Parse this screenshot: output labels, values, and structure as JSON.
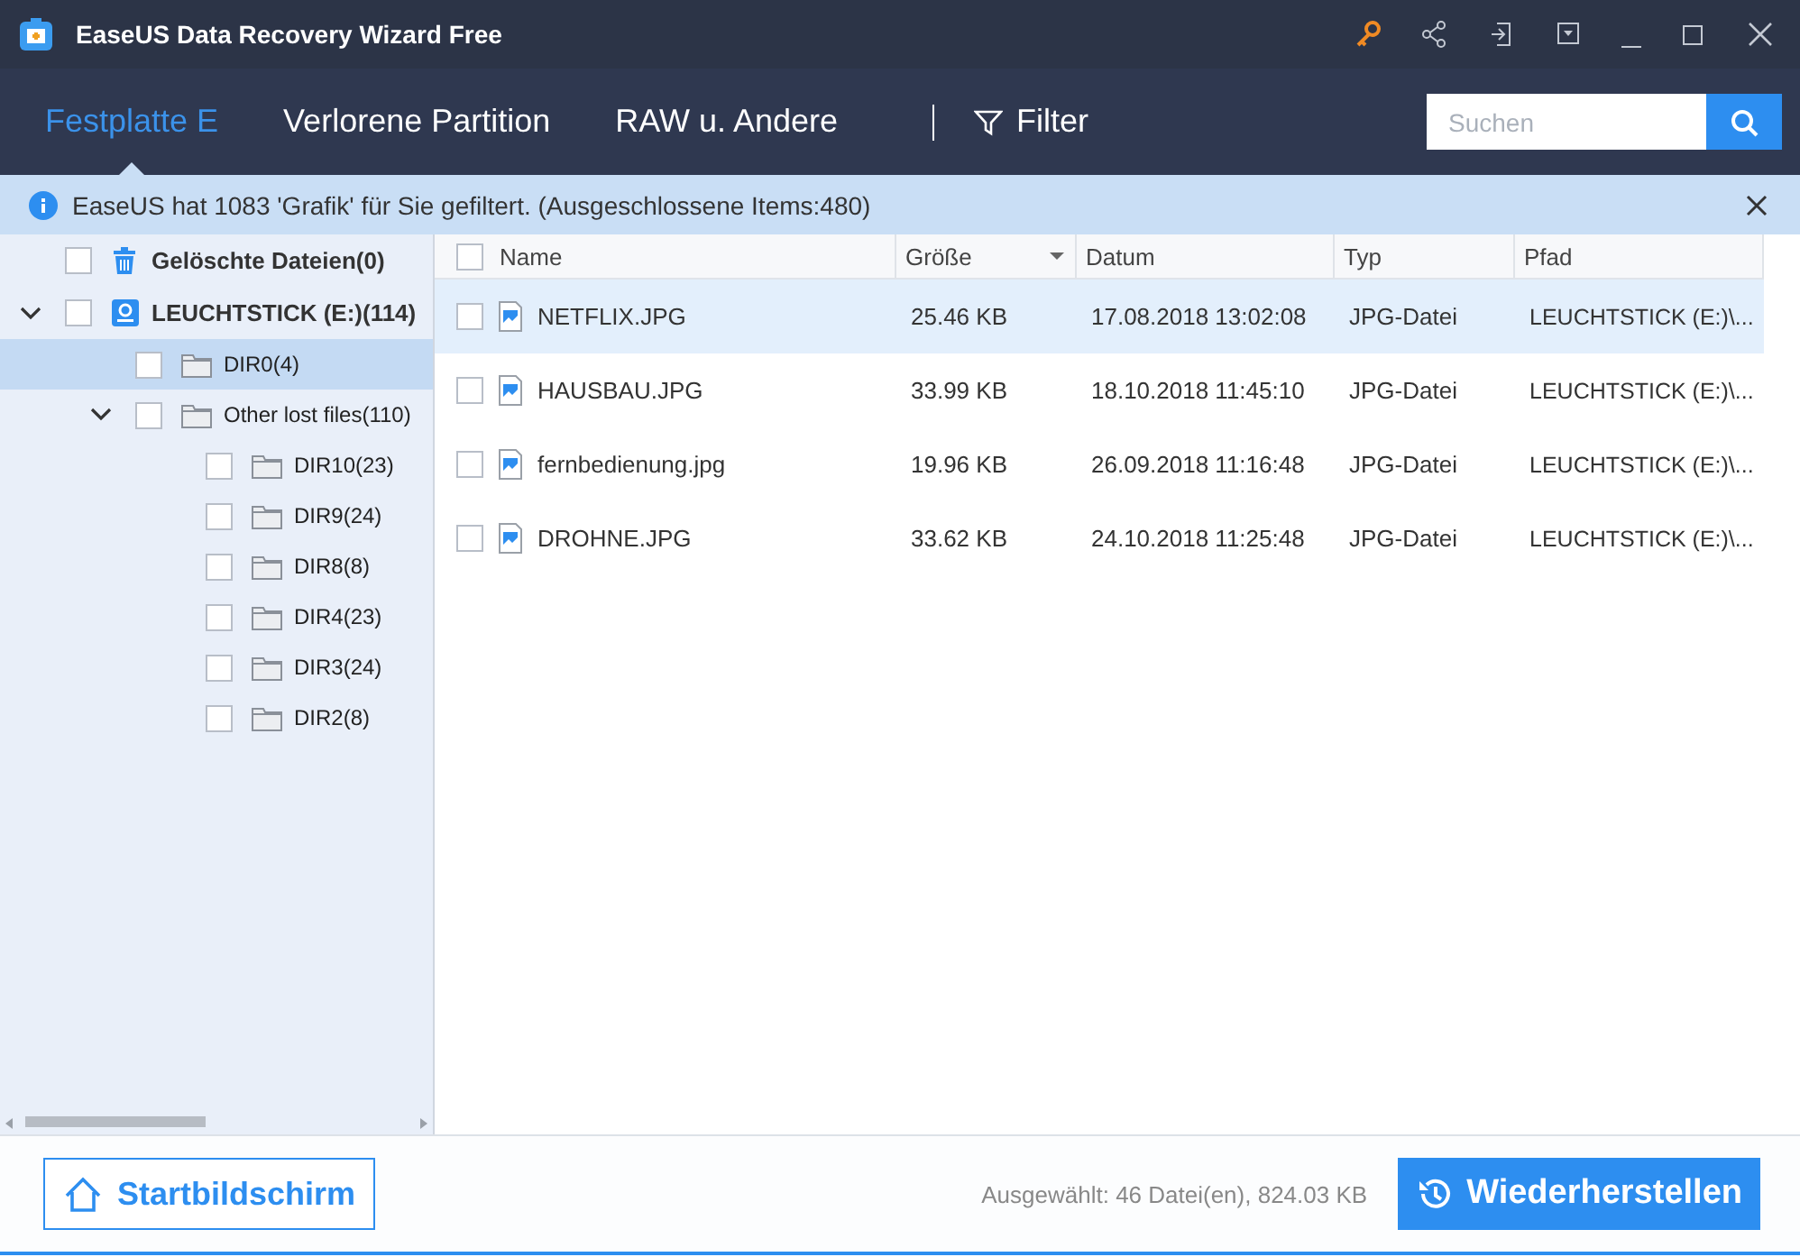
{
  "window": {
    "title": "EaseUS Data Recovery Wizard Free"
  },
  "tabs": [
    {
      "label": "Festplatte E",
      "selected": true
    },
    {
      "label": "Verlorene Partition",
      "selected": false
    },
    {
      "label": "RAW u. Andere",
      "selected": false
    }
  ],
  "filter": {
    "label": "Filter"
  },
  "search": {
    "placeholder": "Suchen"
  },
  "info_bar": {
    "text": "EaseUS hat 1083 'Grafik' für Sie gefiltert. (Ausgeschlossene Items:480)"
  },
  "tree": [
    {
      "label": "Gelöschte Dateien(0)",
      "kind": "trash",
      "checked": false,
      "selected": false
    },
    {
      "label": "LEUCHTSTICK (E:)(114)",
      "kind": "drive",
      "checked": false,
      "selected": false,
      "expanded": true,
      "children": [
        {
          "label": "DIR0(4)",
          "kind": "folder",
          "checked": false,
          "selected": true
        },
        {
          "label": "Other lost files(110)",
          "kind": "folder",
          "checked": false,
          "selected": false,
          "expanded": true,
          "children": [
            {
              "label": "DIR10(23)",
              "kind": "folder",
              "checked": false,
              "selected": false
            },
            {
              "label": "DIR9(24)",
              "kind": "folder",
              "checked": false,
              "selected": false
            },
            {
              "label": "DIR8(8)",
              "kind": "folder",
              "checked": false,
              "selected": false
            },
            {
              "label": "DIR4(23)",
              "kind": "folder",
              "checked": false,
              "selected": false
            },
            {
              "label": "DIR3(24)",
              "kind": "folder",
              "checked": false,
              "selected": false
            },
            {
              "label": "DIR2(8)",
              "kind": "folder",
              "checked": false,
              "selected": false
            }
          ]
        }
      ]
    }
  ],
  "table": {
    "all_checked": false,
    "columns": [
      "Name",
      "Größe",
      "Datum",
      "Typ",
      "Pfad"
    ],
    "rows": [
      {
        "cells": [
          "NETFLIX.JPG",
          "25.46 KB",
          "17.08.2018 13:02:08",
          "JPG-Datei",
          "LEUCHTSTICK (E:)\\..."
        ],
        "checked": false,
        "selected": true
      },
      {
        "cells": [
          "HAUSBAU.JPG",
          "33.99 KB",
          "18.10.2018 11:45:10",
          "JPG-Datei",
          "LEUCHTSTICK (E:)\\..."
        ],
        "checked": false,
        "selected": false
      },
      {
        "cells": [
          "fernbedienung.jpg",
          "19.96 KB",
          "26.09.2018 11:16:48",
          "JPG-Datei",
          "LEUCHTSTICK (E:)\\..."
        ],
        "checked": false,
        "selected": false
      },
      {
        "cells": [
          "DROHNE.JPG",
          "33.62 KB",
          "24.10.2018 11:25:48",
          "JPG-Datei",
          "LEUCHTSTICK (E:)\\..."
        ],
        "checked": false,
        "selected": false
      }
    ]
  },
  "footer": {
    "home_button": "Startbildschirm",
    "selection_summary": "Ausgewählt: 46 Datei(en), 824.03 KB",
    "recover_button": "Wiederherstellen"
  }
}
